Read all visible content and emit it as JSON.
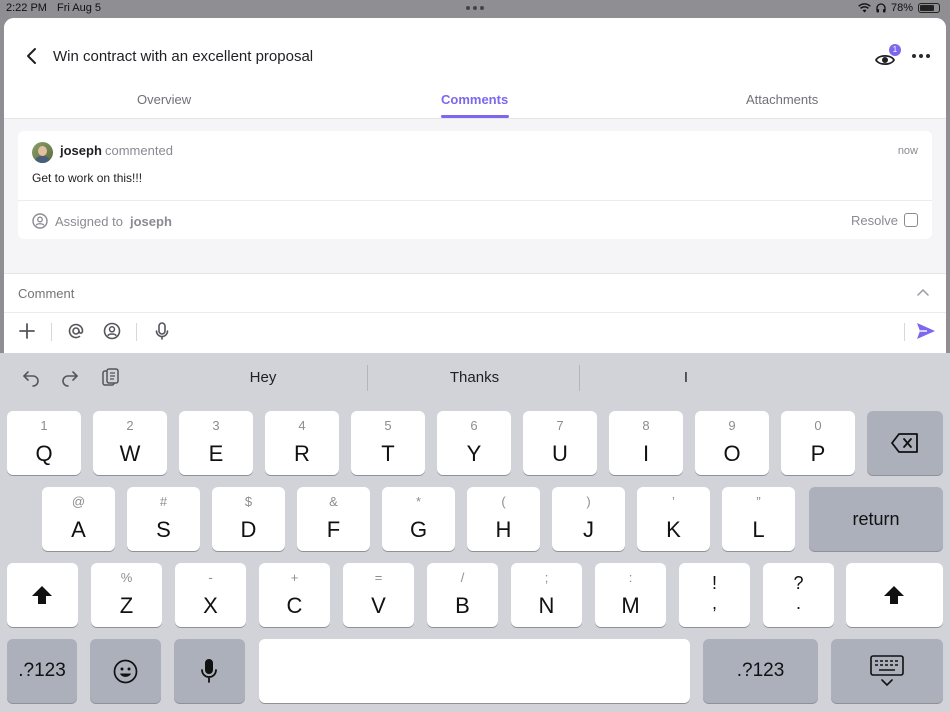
{
  "status_bar": {
    "time": "2:22 PM",
    "date": "Fri Aug 5",
    "battery": "78%",
    "battery_level": 0.78
  },
  "header": {
    "title": "Win contract with an excellent proposal",
    "watchers_count": "1",
    "tabs": [
      {
        "label": "Overview",
        "active": false
      },
      {
        "label": "Comments",
        "active": true
      },
      {
        "label": "Attachments",
        "active": false
      }
    ]
  },
  "comment": {
    "author": "joseph",
    "action": "commented",
    "time": "now",
    "text": "Get to work on this!!!",
    "assigned_label": "Assigned to",
    "assignee": "joseph",
    "resolve_label": "Resolve"
  },
  "composer": {
    "placeholder": "Comment"
  },
  "keyboard": {
    "suggestions": [
      "Hey",
      "Thanks",
      "I"
    ],
    "row1": [
      {
        "hint": "1",
        "key": "Q"
      },
      {
        "hint": "2",
        "key": "W"
      },
      {
        "hint": "3",
        "key": "E"
      },
      {
        "hint": "4",
        "key": "R"
      },
      {
        "hint": "5",
        "key": "T"
      },
      {
        "hint": "6",
        "key": "Y"
      },
      {
        "hint": "7",
        "key": "U"
      },
      {
        "hint": "8",
        "key": "I"
      },
      {
        "hint": "9",
        "key": "O"
      },
      {
        "hint": "0",
        "key": "P"
      }
    ],
    "row2": [
      {
        "hint": "@",
        "key": "A"
      },
      {
        "hint": "#",
        "key": "S"
      },
      {
        "hint": "$",
        "key": "D"
      },
      {
        "hint": "&",
        "key": "F"
      },
      {
        "hint": "*",
        "key": "G"
      },
      {
        "hint": "(",
        "key": "H"
      },
      {
        "hint": ")",
        "key": "J"
      },
      {
        "hint": "’",
        "key": "K"
      },
      {
        "hint": "”",
        "key": "L"
      }
    ],
    "return_label": "return",
    "row3": [
      {
        "hint": "%",
        "key": "Z"
      },
      {
        "hint": "-",
        "key": "X"
      },
      {
        "hint": "+",
        "key": "C"
      },
      {
        "hint": "=",
        "key": "V"
      },
      {
        "hint": "/",
        "key": "B"
      },
      {
        "hint": ";",
        "key": "N"
      },
      {
        "hint": ":",
        "key": "M"
      }
    ],
    "punct": [
      {
        "top": "!",
        "bottom": ","
      },
      {
        "top": "?",
        "bottom": "."
      }
    ],
    "numbers_label": ".?123"
  },
  "colors": {
    "accent": "#7b68ee",
    "keyboard_bg": "#d1d3d9",
    "key_dark": "#abb0bb"
  },
  "icons": [
    "back-icon",
    "eye-icon",
    "more-icon",
    "plus-icon",
    "mention-icon",
    "assign-icon",
    "mic-icon",
    "send-icon",
    "undo-icon",
    "redo-icon",
    "clipboard-icon",
    "delete-icon",
    "shift-icon",
    "emoji-icon",
    "keyboard-dismiss-icon"
  ]
}
